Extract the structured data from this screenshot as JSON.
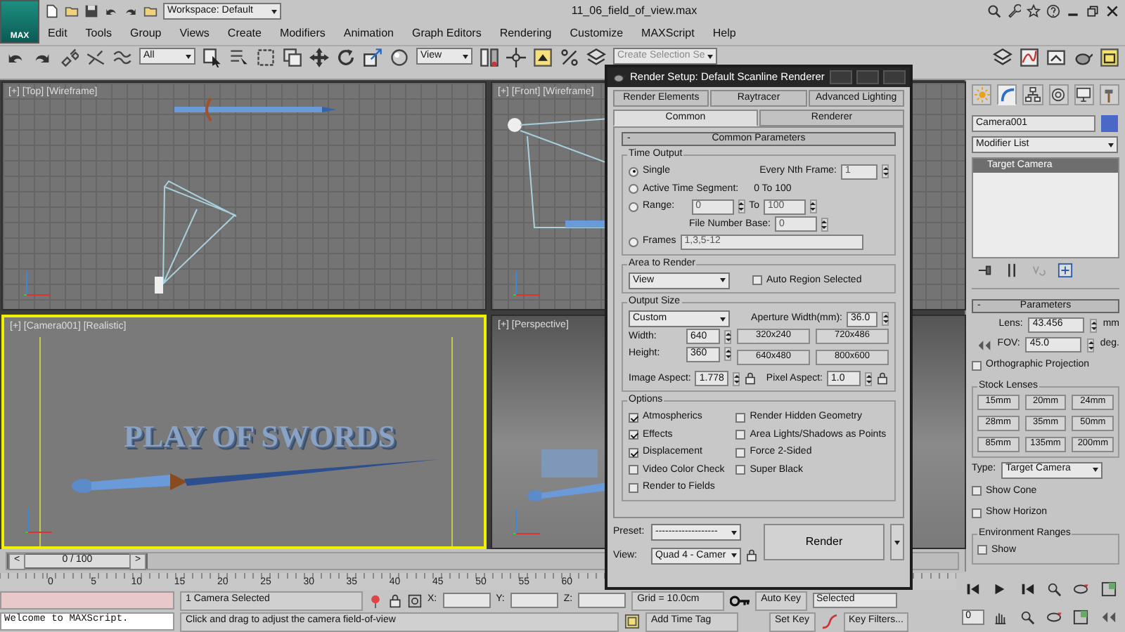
{
  "title_bar": {
    "app_button": "MAX",
    "workspace": "Workspace: Default",
    "file_name": "11_06_field_of_view.max"
  },
  "menu": [
    "Edit",
    "Tools",
    "Group",
    "Views",
    "Create",
    "Modifiers",
    "Animation",
    "Graph Editors",
    "Rendering",
    "Customize",
    "MAXScript",
    "Help"
  ],
  "toolbar": {
    "selection_filter": "All",
    "reference_coord": "View",
    "selection_set": {
      "placeholder": "Create Selection Se"
    }
  },
  "viewports": [
    {
      "label": "[+] [Top] [Wireframe]",
      "kind": "top",
      "active": false
    },
    {
      "label": "[+] [Front] [Wireframe]",
      "kind": "front",
      "active": false
    },
    {
      "label": "[+] [Camera001] [Realistic]",
      "kind": "camera",
      "active": true,
      "scene_text": "PLAY OF SWORDS"
    },
    {
      "label": "[+] [Perspective]",
      "kind": "perspective",
      "active": false
    }
  ],
  "timeline": {
    "prev": "<",
    "position": "0 / 100",
    "next": ">",
    "level": 0
  },
  "ruler_ticks": [
    "0",
    "5",
    "10",
    "15",
    "20",
    "25",
    "30",
    "35",
    "40",
    "45",
    "50",
    "55",
    "60"
  ],
  "command_panel": {
    "tabs": [
      {
        "kind": "create",
        "selected": false
      },
      {
        "kind": "modify",
        "selected": true
      },
      {
        "kind": "hierarchy",
        "selected": false
      },
      {
        "kind": "motion",
        "selected": false
      },
      {
        "kind": "display",
        "selected": false
      },
      {
        "kind": "utilities",
        "selected": false
      }
    ],
    "object_name": "Camera001",
    "modifier_list": "Modifier List",
    "stack": [
      {
        "label": "Target Camera",
        "selected": true
      }
    ],
    "parameters": {
      "title": "Parameters",
      "toggle": "-",
      "lens": {
        "label": "Lens:",
        "value": "43.456",
        "unit": "mm"
      },
      "fov": {
        "label": "FOV:",
        "value": "45.0",
        "unit": "deg."
      },
      "orthographic": {
        "label": "Orthographic Projection",
        "checked": false
      },
      "stock_lenses": {
        "title": "Stock Lenses",
        "buttons": [
          "15mm",
          "20mm",
          "24mm",
          "28mm",
          "35mm",
          "50mm",
          "85mm",
          "135mm",
          "200mm"
        ]
      },
      "type": {
        "label": "Type:",
        "value": "Target Camera"
      },
      "checkboxes": [
        {
          "label": "Show Cone",
          "checked": false
        },
        {
          "label": "Show Horizon",
          "checked": false
        }
      ],
      "environment_ranges": {
        "title": "Environment Ranges",
        "show": {
          "label": "Show",
          "checked": false
        }
      }
    },
    "frame_field": "0"
  },
  "status": {
    "listener": "Welcome to MAXScript.",
    "selection": "1 Camera Selected",
    "coords": [
      "X:",
      "Y:",
      "Z:"
    ],
    "grid": "Grid = 10.0cm",
    "prompt": "Click and drag to adjust the camera field-of-view",
    "time_tag": "Add Time Tag",
    "auto_key": "Auto Key",
    "key_mode": "Selected",
    "set_key": "Set Key",
    "key_filters": "Key Filters..."
  },
  "render_setup": {
    "title": "Render Setup: Default Scanline Renderer",
    "tabs_row1": [
      {
        "label": "Render Elements",
        "selected": false
      },
      {
        "label": "Raytracer",
        "selected": false
      },
      {
        "label": "Advanced Lighting",
        "selected": false
      }
    ],
    "tabs_row2": [
      {
        "label": "Common",
        "selected": true
      },
      {
        "label": "Renderer",
        "selected": false
      }
    ],
    "rollout": {
      "toggle": "-",
      "title": "Common Parameters"
    },
    "time_output": {
      "title": "Time Output",
      "options": [
        {
          "label": "Single",
          "selected": true
        },
        {
          "label": "Active Time Segment:",
          "selected": false
        },
        {
          "label": "Range:",
          "selected": false
        },
        {
          "label": "Frames",
          "selected": false
        }
      ],
      "every_nth": {
        "label": "Every Nth Frame:",
        "value": "1"
      },
      "segment": "0 To 100",
      "range_from": "0",
      "range_to_label": "To",
      "range_to": "100",
      "file_number_base": {
        "label": "File Number Base:",
        "value": "0"
      },
      "frames": "1,3,5-12"
    },
    "area_to_render": {
      "title": "Area to Render",
      "value": "View",
      "auto_region": {
        "label": "Auto Region Selected",
        "checked": false
      }
    },
    "output_size": {
      "title": "Output Size",
      "preset": "Custom",
      "aperture": {
        "label": "Aperture Width(mm):",
        "value": "36.0"
      },
      "width": {
        "label": "Width:",
        "value": "640"
      },
      "height": {
        "label": "Height:",
        "value": "360"
      },
      "presets": [
        "320x240",
        "720x486",
        "640x480",
        "800x600"
      ],
      "image_aspect": {
        "label": "Image Aspect:",
        "value": "1.778"
      },
      "pixel_aspect": {
        "label": "Pixel Aspect:",
        "value": "1.0"
      }
    },
    "options": {
      "title": "Options",
      "left": [
        {
          "label": "Atmospherics",
          "checked": true
        },
        {
          "label": "Effects",
          "checked": true
        },
        {
          "label": "Displacement",
          "checked": true
        },
        {
          "label": "Video Color Check",
          "checked": false
        },
        {
          "label": "Render to Fields",
          "checked": false
        }
      ],
      "right": [
        {
          "label": "Render Hidden Geometry",
          "checked": false
        },
        {
          "label": "Area Lights/Shadows as Points",
          "checked": false
        },
        {
          "label": "Force 2-Sided",
          "checked": false
        },
        {
          "label": "Super Black",
          "checked": false
        }
      ]
    },
    "preset": {
      "label": "Preset:",
      "value": "-------------------"
    },
    "view": {
      "label": "View:",
      "value": "Quad 4 - Camer"
    },
    "render_button": "Render"
  }
}
